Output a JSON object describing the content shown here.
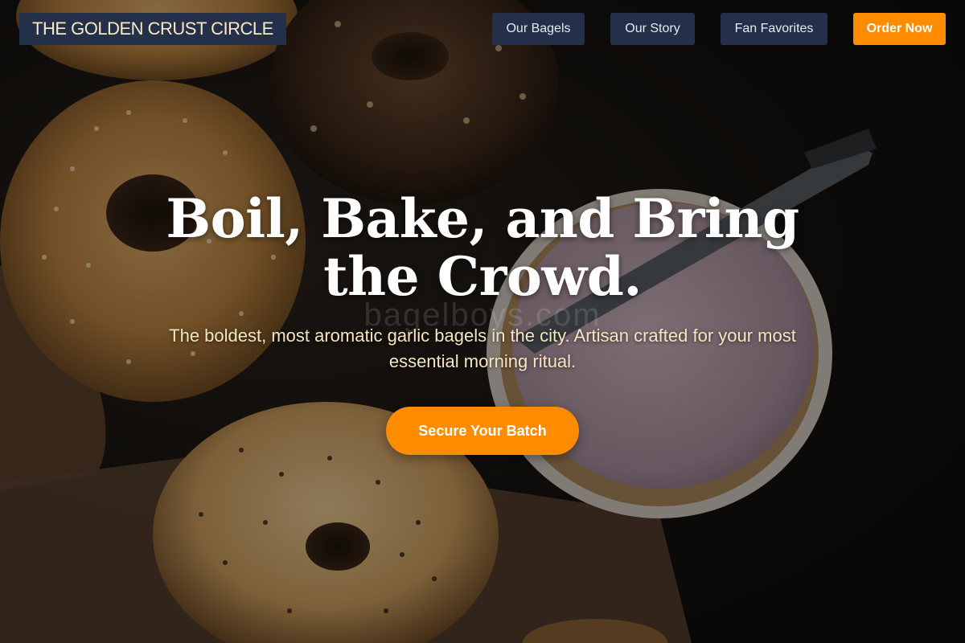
{
  "brand": {
    "name": "THE GOLDEN CRUST CIRCLE"
  },
  "nav": {
    "items": [
      {
        "label": "Our Bagels"
      },
      {
        "label": "Our Story"
      },
      {
        "label": "Fan Favorites"
      }
    ],
    "order_label": "Order Now"
  },
  "hero": {
    "headline": "Boil, Bake, and Bring the Crowd.",
    "subtext": "The boldest, most aromatic garlic bagels in the city. Artisan crafted for your most essential morning ritual.",
    "cta_label": "Secure Your Batch",
    "watermark": "bagelboys.com",
    "background_image": "dark-table-with-sesame-everything-bagels-and-cream-cheese-bowl"
  },
  "colors": {
    "accent": "#ff8c00",
    "nav_bg": "#24304a",
    "logo_text": "#f8e9c4",
    "subtext": "#f5e6c0",
    "headline": "#ffffff"
  }
}
